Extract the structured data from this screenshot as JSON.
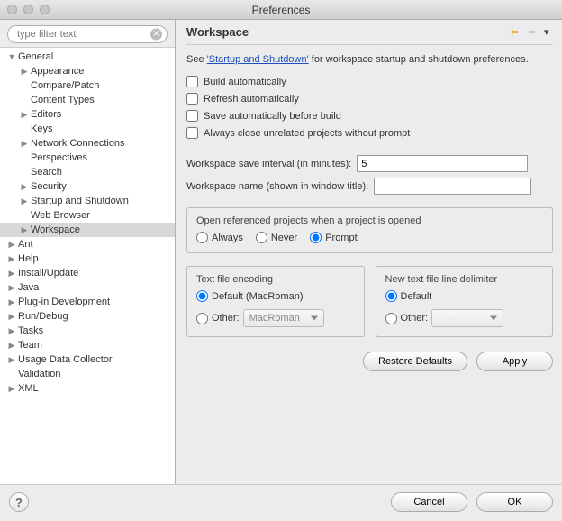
{
  "window": {
    "title": "Preferences"
  },
  "filter": {
    "placeholder": "type filter text"
  },
  "tree": [
    {
      "label": "General",
      "depth": 0,
      "tw": "down",
      "sel": false
    },
    {
      "label": "Appearance",
      "depth": 1,
      "tw": "right",
      "sel": false
    },
    {
      "label": "Compare/Patch",
      "depth": 1,
      "tw": "",
      "sel": false
    },
    {
      "label": "Content Types",
      "depth": 1,
      "tw": "",
      "sel": false
    },
    {
      "label": "Editors",
      "depth": 1,
      "tw": "right",
      "sel": false
    },
    {
      "label": "Keys",
      "depth": 1,
      "tw": "",
      "sel": false
    },
    {
      "label": "Network Connections",
      "depth": 1,
      "tw": "right",
      "sel": false
    },
    {
      "label": "Perspectives",
      "depth": 1,
      "tw": "",
      "sel": false
    },
    {
      "label": "Search",
      "depth": 1,
      "tw": "",
      "sel": false
    },
    {
      "label": "Security",
      "depth": 1,
      "tw": "right",
      "sel": false
    },
    {
      "label": "Startup and Shutdown",
      "depth": 1,
      "tw": "right",
      "sel": false
    },
    {
      "label": "Web Browser",
      "depth": 1,
      "tw": "",
      "sel": false
    },
    {
      "label": "Workspace",
      "depth": 1,
      "tw": "right",
      "sel": true
    },
    {
      "label": "Ant",
      "depth": 0,
      "tw": "right",
      "sel": false
    },
    {
      "label": "Help",
      "depth": 0,
      "tw": "right",
      "sel": false
    },
    {
      "label": "Install/Update",
      "depth": 0,
      "tw": "right",
      "sel": false
    },
    {
      "label": "Java",
      "depth": 0,
      "tw": "right",
      "sel": false
    },
    {
      "label": "Plug-in Development",
      "depth": 0,
      "tw": "right",
      "sel": false
    },
    {
      "label": "Run/Debug",
      "depth": 0,
      "tw": "right",
      "sel": false
    },
    {
      "label": "Tasks",
      "depth": 0,
      "tw": "right",
      "sel": false
    },
    {
      "label": "Team",
      "depth": 0,
      "tw": "right",
      "sel": false
    },
    {
      "label": "Usage Data Collector",
      "depth": 0,
      "tw": "right",
      "sel": false
    },
    {
      "label": "Validation",
      "depth": 0,
      "tw": "",
      "sel": false
    },
    {
      "label": "XML",
      "depth": 0,
      "tw": "right",
      "sel": false
    }
  ],
  "page": {
    "title": "Workspace",
    "desc_prefix": "See ",
    "desc_link": "'Startup and Shutdown'",
    "desc_suffix": " for workspace startup and shutdown preferences.",
    "check1": "Build automatically",
    "check2": "Refresh automatically",
    "check3": "Save automatically before build",
    "check4": "Always close unrelated projects without prompt",
    "interval_label": "Workspace save interval (in minutes):",
    "interval_value": "5",
    "wsname_label": "Workspace name (shown in window title):",
    "wsname_value": "",
    "ref_legend": "Open referenced projects when a project is opened",
    "ref_always": "Always",
    "ref_never": "Never",
    "ref_prompt": "Prompt",
    "enc_legend": "Text file encoding",
    "enc_default": "Default (MacRoman)",
    "enc_other": "Other:",
    "enc_other_value": "MacRoman",
    "delim_legend": "New text file line delimiter",
    "delim_default": "Default",
    "delim_other": "Other:",
    "delim_other_value": "",
    "restore": "Restore Defaults",
    "apply": "Apply",
    "cancel": "Cancel",
    "ok": "OK"
  }
}
